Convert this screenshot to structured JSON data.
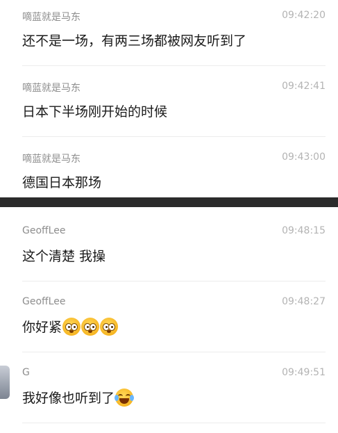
{
  "messages_top": [
    {
      "sender": "嘀蓝就是马东",
      "time": "09:42:20",
      "text": "还不是一场，有两三场都被网友听到了"
    },
    {
      "sender": "嘀蓝就是马东",
      "time": "09:42:41",
      "text": "日本下半场刚开始的时候"
    },
    {
      "sender": "嘀蓝就是马东",
      "time": "09:43:00",
      "text": "德国日本那场"
    }
  ],
  "messages_bottom": [
    {
      "sender": "GeoffLee",
      "time": "09:48:15",
      "text": "这个清楚 我操"
    },
    {
      "sender": "GeoffLee",
      "time": "09:48:27",
      "text": "你好紧",
      "emojis": [
        "flushed-face-icon",
        "flushed-face-icon",
        "flushed-face-icon"
      ]
    },
    {
      "sender": "G",
      "time": "09:49:51",
      "text": "我好像也听到了",
      "emojis": [
        "tears-of-joy-icon"
      ]
    }
  ]
}
